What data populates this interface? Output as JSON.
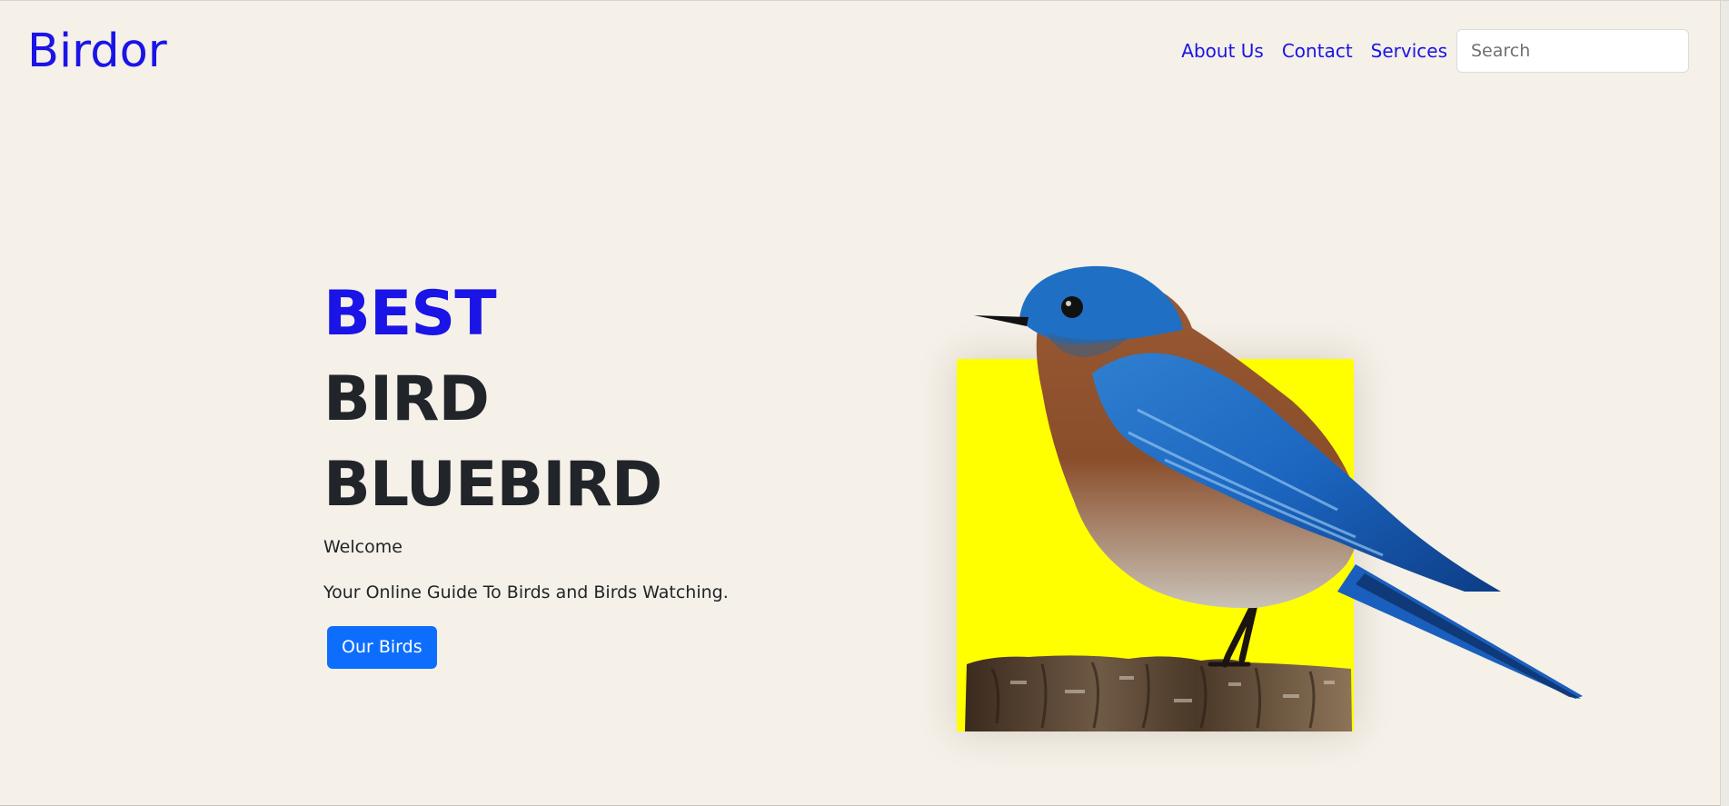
{
  "header": {
    "brand": "Birdor",
    "nav": [
      "About Us",
      "Contact",
      "Services"
    ],
    "search_placeholder": "Search"
  },
  "hero": {
    "line1": "BEST",
    "line2": "BIRD",
    "line3": "BLUEBIRD",
    "welcome": "Welcome",
    "tagline": "Your Online Guide To Birds and Birds Watching.",
    "cta_label": "Our Birds"
  },
  "colors": {
    "background": "#f5f0e8",
    "brand": "#1a14e6",
    "button": "#0d6efd",
    "card": "#ffff00",
    "text": "#212529"
  }
}
